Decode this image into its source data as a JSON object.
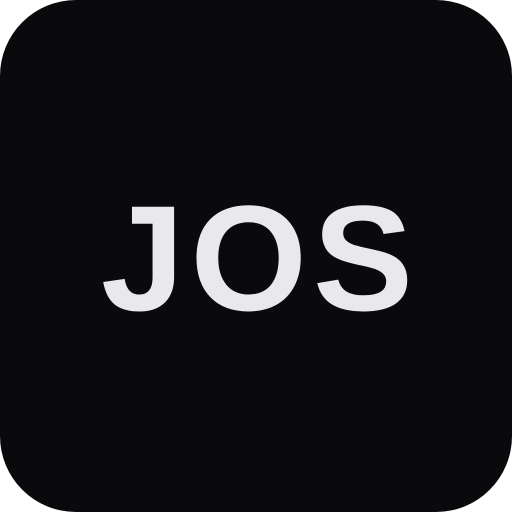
{
  "app_icon": {
    "label": "JOS",
    "background_color": "#0a0a0c",
    "text_color": "#e9e9eb"
  }
}
